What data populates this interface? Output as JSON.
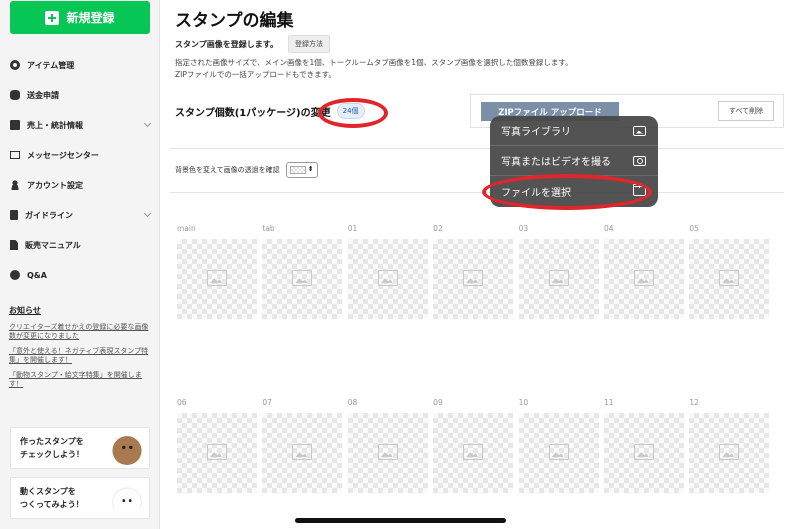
{
  "sidebar": {
    "new_button": "新規登録",
    "items": [
      {
        "label": "アイテム管理",
        "icon": "gear-icon",
        "chevron": false
      },
      {
        "label": "送金申請",
        "icon": "coins-icon",
        "chevron": false
      },
      {
        "label": "売上・統計情報",
        "icon": "chart-icon",
        "chevron": true
      },
      {
        "label": "メッセージセンター",
        "icon": "mail-icon",
        "chevron": false
      },
      {
        "label": "アカウント設定",
        "icon": "user-icon",
        "chevron": false
      },
      {
        "label": "ガイドライン",
        "icon": "book-icon",
        "chevron": true
      },
      {
        "label": "販売マニュアル",
        "icon": "document-icon",
        "chevron": false
      },
      {
        "label": "Q&A",
        "icon": "question-icon",
        "chevron": false
      }
    ],
    "notice": {
      "title": "お知らせ",
      "links": [
        "クリエイターズ着せかえの登録に必要な画像数が変更になりました",
        "「意外と使える！ネガティブ表現スタンプ特集」を開催します！",
        "「動物スタンプ・絵文字特集」を開催します！"
      ]
    },
    "promos": [
      {
        "line1": "作ったスタンプを",
        "line2": "チェックしよう！"
      },
      {
        "line1": "動くスタンプを",
        "line2": "つくってみよう！"
      }
    ]
  },
  "main": {
    "title": "スタンプの編集",
    "register_label": "スタンプ画像を登録します。",
    "register_method_button": "登録方法",
    "description_line1": "指定された画像サイズで、メイン画像を1個、トークルームタブ画像を1個、スタンプ画像を選択した個数登録します。",
    "description_line2": "ZIPファイルでの一括アップロードもできます。",
    "count_label": "スタンプ個数(1パッケージ)の変更",
    "count_value": "24個",
    "zip_upload_button": "ZIPファイル アップロード",
    "delete_all_button": "すべて削除",
    "bg_label": "背景色を変えて画像の透過を確認",
    "row1": [
      "main",
      "tab",
      "01",
      "02",
      "03",
      "04",
      "05"
    ],
    "row2": [
      "06",
      "07",
      "08",
      "09",
      "10",
      "11",
      "12"
    ]
  },
  "popup": {
    "items": [
      {
        "label": "写真ライブラリ",
        "icon": "photo-library-icon"
      },
      {
        "label": "写真またはビデオを撮る",
        "icon": "camera-icon"
      },
      {
        "label": "ファイルを選択",
        "icon": "folder-icon"
      }
    ]
  },
  "colors": {
    "brand_green": "#06c755",
    "annotation_red": "#e0262a",
    "zip_button": "#7b8fa8"
  }
}
